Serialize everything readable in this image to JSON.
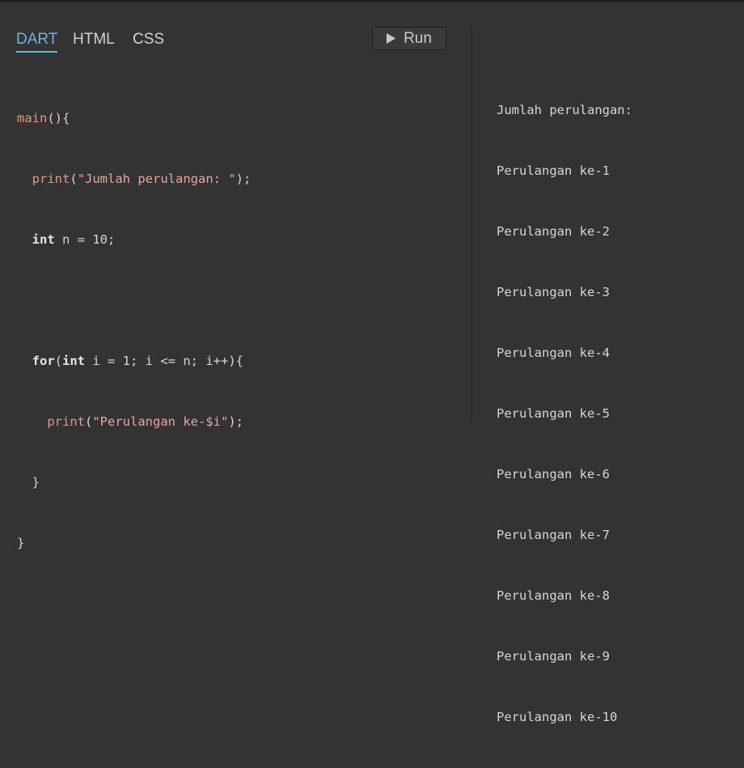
{
  "tabs": [
    {
      "label": "DART",
      "active": true
    },
    {
      "label": "HTML",
      "active": false
    },
    {
      "label": "CSS",
      "active": false
    }
  ],
  "run_button": {
    "label": "Run",
    "icon": "play-icon"
  },
  "code": {
    "l1_main": "main",
    "l1_rest": "(){",
    "l2_print": "print",
    "l2_open": "(",
    "l2_str": "\"Jumlah perulangan: \"",
    "l2_close": ");",
    "l3_kw": "int",
    "l3_rest": " n = 10;",
    "l5_for": "for",
    "l5_open": "(",
    "l5_int": "int",
    "l5_rest": " i = 1; i <= n; i++){",
    "l6_print": "print",
    "l6_open": "(",
    "l6_str": "\"Perulangan ke-$i\"",
    "l6_close": ");",
    "l7_close": "}",
    "l8_close": "}"
  },
  "output": {
    "lines": [
      "Jumlah perulangan:",
      "Perulangan ke-1",
      "Perulangan ke-2",
      "Perulangan ke-3",
      "Perulangan ke-4",
      "Perulangan ke-5",
      "Perulangan ke-6",
      "Perulangan ke-7",
      "Perulangan ke-8",
      "Perulangan ke-9",
      "Perulangan ke-10"
    ]
  },
  "colors": {
    "background": "#333333",
    "active_tab": "#66b8df",
    "string": "#e8a79a",
    "function": "#e09a7c"
  }
}
